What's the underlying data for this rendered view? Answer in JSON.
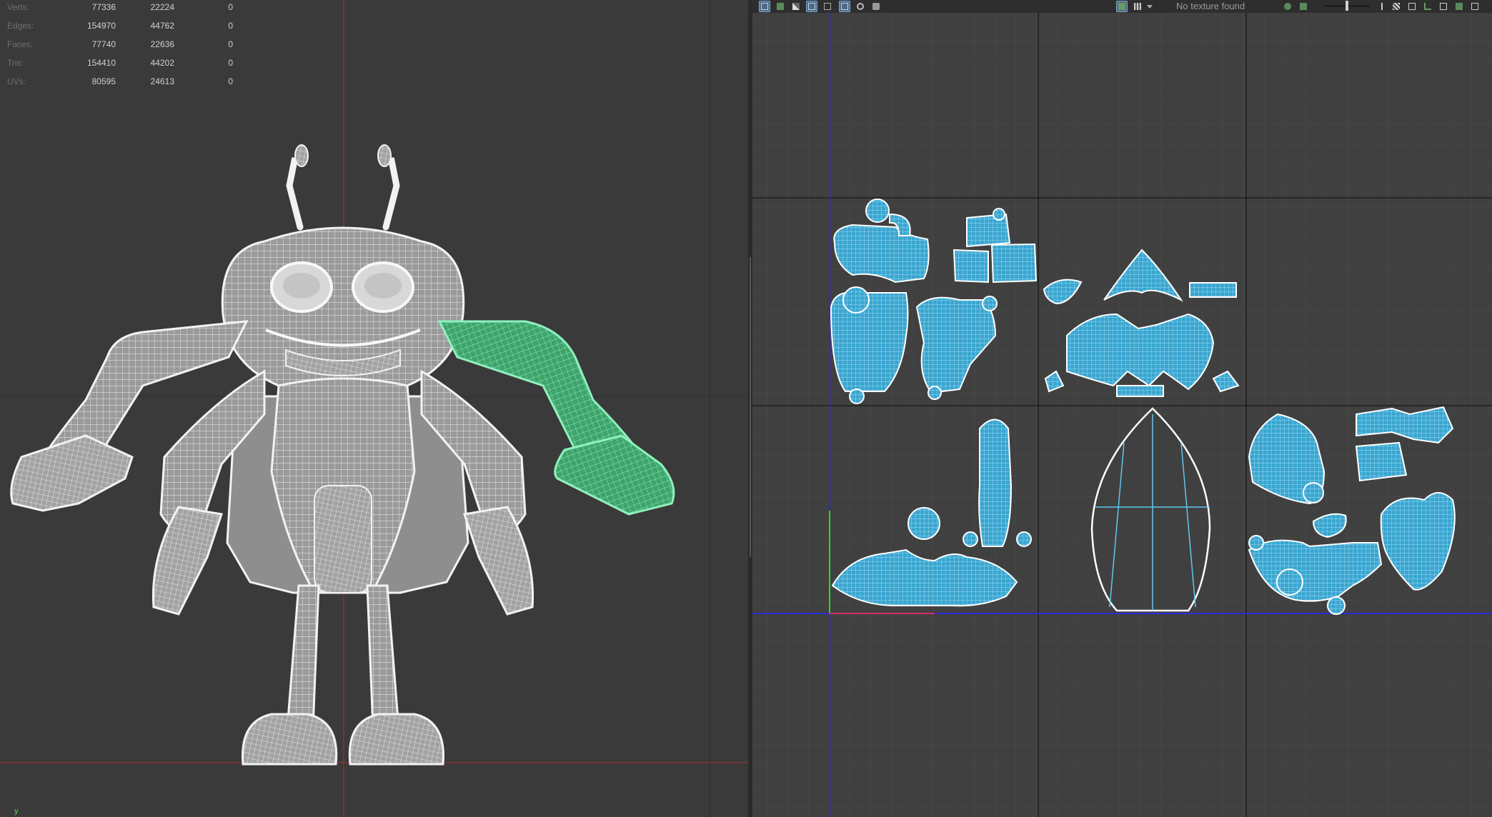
{
  "stats": {
    "rows": [
      {
        "label": "Verts:",
        "selected": "77336",
        "uv_shell": "22224",
        "other": "0"
      },
      {
        "label": "Edges:",
        "selected": "154970",
        "uv_shell": "44762",
        "other": "0"
      },
      {
        "label": "Faces:",
        "selected": "77740",
        "uv_shell": "22636",
        "other": "0"
      },
      {
        "label": "Tris:",
        "selected": "154410",
        "uv_shell": "44202",
        "other": "0"
      },
      {
        "label": "UVs:",
        "selected": "80595",
        "uv_shell": "24613",
        "other": "0"
      }
    ]
  },
  "viewport": {
    "axis_label": "y",
    "wire_color": "#f2f2f2",
    "mesh_color": "#9b9b9b",
    "selection_color": "#4fdc8c",
    "grid_axis_color": "#b22a2a"
  },
  "uv_editor": {
    "texture_status": "No texture found",
    "shell_color": "#5fc8ec",
    "u_axis_color": "#2b2bd8",
    "v_axis_color": "#2bd82b",
    "toolbar_icons": [
      "uv-grid-icon",
      "uv-shell-icon",
      "checker-icon",
      "image-icon",
      "wireframe-icon",
      "isolate-icon",
      "snapshot-icon",
      "camera-icon",
      "display-image-icon",
      "checker-toggle-icon",
      "dropdown-icon",
      "exposure-icon",
      "display-options-icon",
      "lock-icon",
      "toggle-filter-icon",
      "refresh-icon",
      "frame-icon",
      "settings-icon",
      "pin-icon",
      "close-icon"
    ],
    "exposure_level": 0.5
  }
}
